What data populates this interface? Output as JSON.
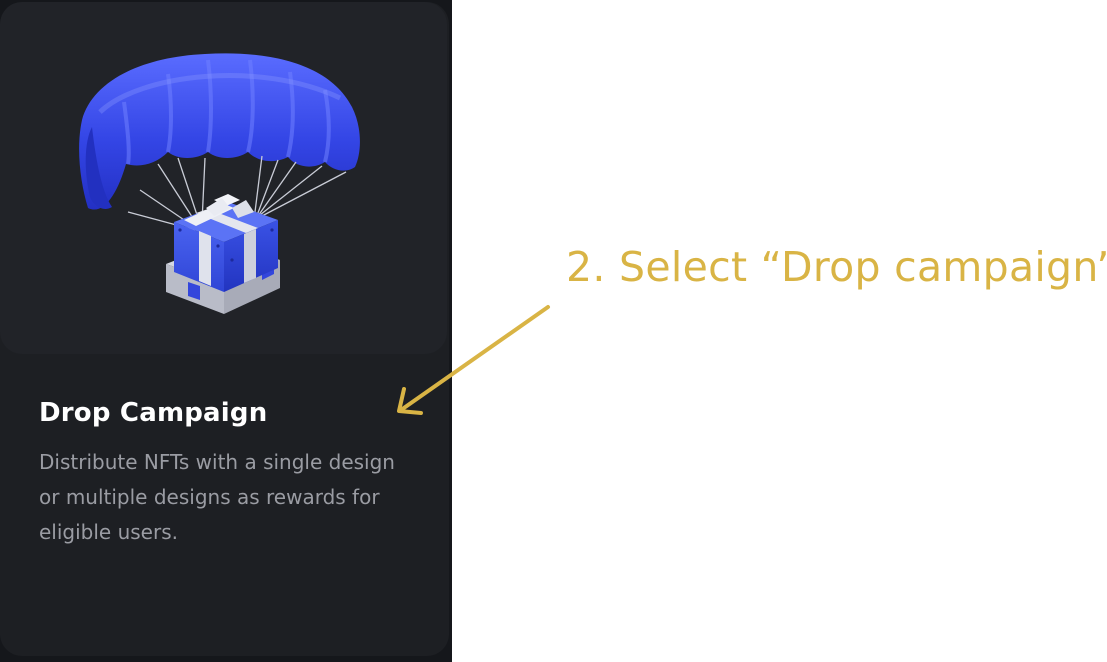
{
  "card": {
    "title": "Drop Campaign",
    "description": "Distribute NFTs with a single design or multiple designs as rewards for eligible users.",
    "illustration": "parachute-gift-box-illustration"
  },
  "annotation": {
    "text": "2. Select “Drop campaign”",
    "color": "#d9b445"
  },
  "colors": {
    "card_background": "#1d1f23",
    "parachute_blue": "#3b4fe8",
    "title": "#ffffff",
    "description": "#9a9ca3"
  }
}
